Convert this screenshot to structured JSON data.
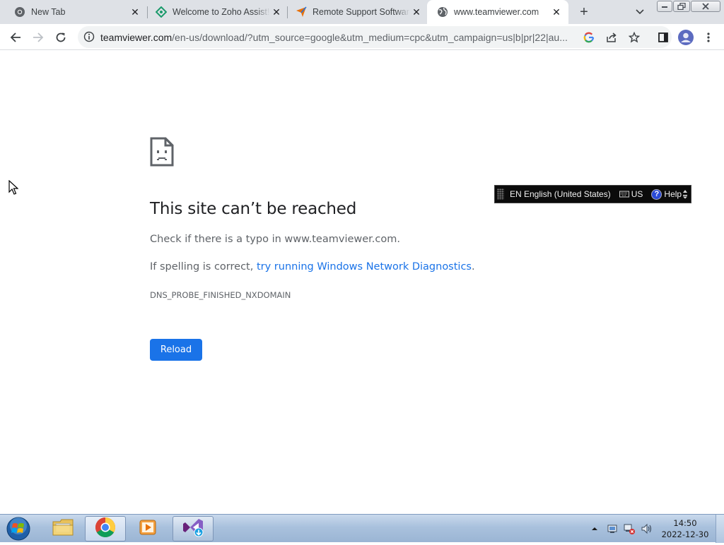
{
  "browser": {
    "tabs": [
      {
        "title": "New Tab",
        "icon": "chrome-icon",
        "active": false
      },
      {
        "title": "Welcome to Zoho Assist!",
        "icon": "zoho-assist-icon",
        "active": false
      },
      {
        "title": "Remote Support Software",
        "icon": "remote-support-icon",
        "active": false
      },
      {
        "title": "www.teamviewer.com",
        "icon": "globe-icon",
        "active": true
      }
    ],
    "new_tab_symbol": "+",
    "close_symbol": "✕",
    "address": {
      "host": "teamviewer.com",
      "path": "/en-us/download/?utm_source=google&utm_medium=cpc&utm_campaign=us|b|pr|22|au..."
    }
  },
  "error_page": {
    "title": "This site can’t be reached",
    "line1": "Check if there is a typo in www.teamviewer.com.",
    "line2_prefix": "If spelling is correct, ",
    "line2_link": "try running Windows Network Diagnostics",
    "line2_suffix": ".",
    "code": "DNS_PROBE_FINISHED_NXDOMAIN",
    "reload_label": "Reload"
  },
  "language_bar": {
    "language": "EN English (United States)",
    "keyboard": "US",
    "help": "Help",
    "help_glyph": "?"
  },
  "taskbar": {
    "apps": [
      {
        "name": "windows-explorer",
        "active": false
      },
      {
        "name": "google-chrome",
        "active": true
      },
      {
        "name": "media-player",
        "active": false
      },
      {
        "name": "visual-studio-installer",
        "active": false
      }
    ],
    "clock": {
      "time": "14:50",
      "date": "2022-12-30"
    }
  },
  "colors": {
    "link": "#1a73e8",
    "button": "#1a73e8",
    "tabstrip": "#dee1e6",
    "omnibox": "#f1f3f4"
  }
}
